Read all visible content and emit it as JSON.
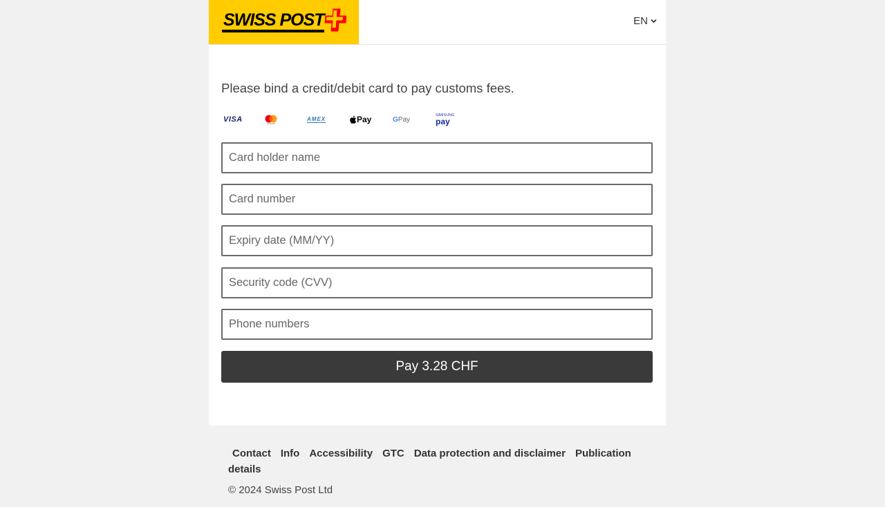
{
  "header": {
    "logo_text": "SWISS POST",
    "language": "EN"
  },
  "form": {
    "intro": "Please bind a credit/debit card to pay customs fees.",
    "payment_methods": [
      "VISA",
      "Mastercard",
      "AMEX",
      "Apple Pay",
      "Google Pay",
      "Samsung Pay"
    ],
    "brand_labels": {
      "visa": "VISA",
      "amex": "AMEX",
      "apple_pay": "Pay",
      "google_pay_g": "G",
      "google_pay": "Pay",
      "samsung_top": "SAMSUNG",
      "samsung_bottom": "pay"
    },
    "fields": {
      "card_holder_placeholder": "Card holder name",
      "card_number_placeholder": "Card number",
      "expiry_placeholder": "Expiry date (MM/YY)",
      "cvv_placeholder": "Security code (CVV)",
      "phone_placeholder": "Phone numbers"
    },
    "pay_button": "Pay 3.28 CHF"
  },
  "footer": {
    "links": [
      "Contact",
      "Info",
      "Accessibility",
      "GTC",
      "Data protection and disclaimer",
      "Publication details"
    ],
    "copyright": "© 2024 Swiss Post Ltd"
  },
  "colors": {
    "brand_yellow": "#ffcc00",
    "brand_red": "#ff0000",
    "button_dark": "#3a3a3a",
    "page_bg": "#f1f1f1"
  }
}
